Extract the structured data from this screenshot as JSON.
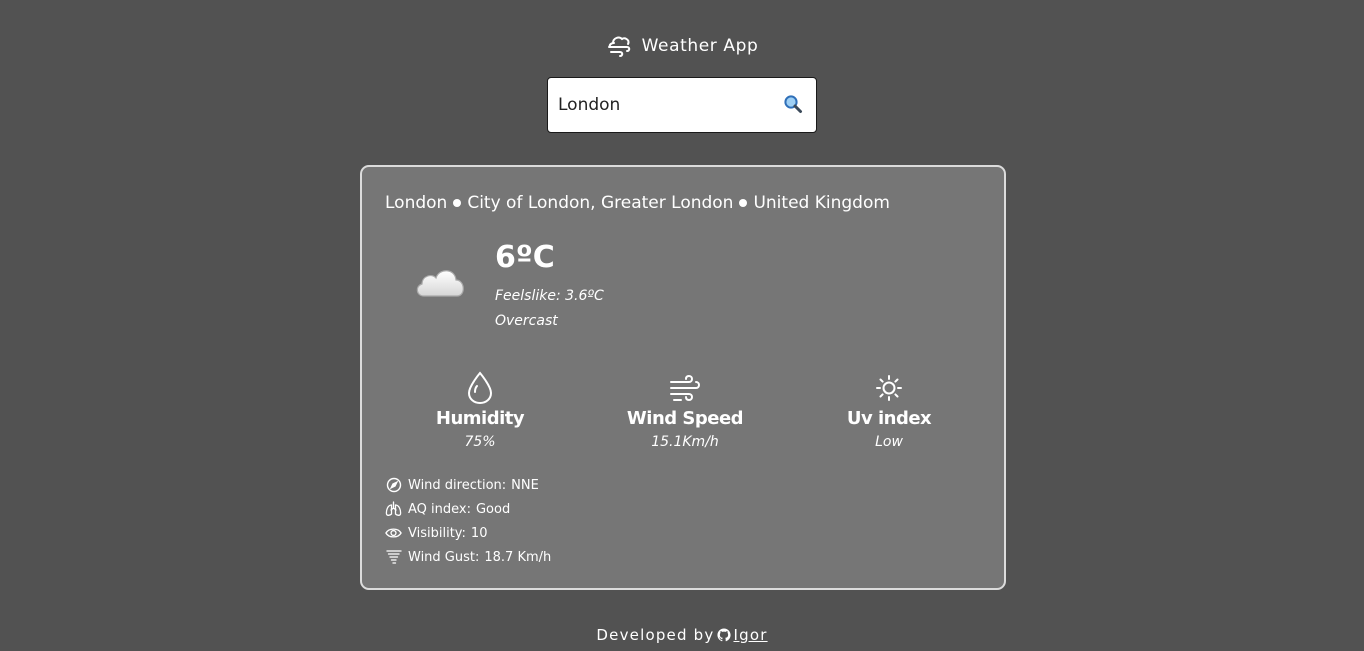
{
  "header": {
    "title": "Weather App",
    "logo_icon": "cloud-wind-icon"
  },
  "search": {
    "value": "London",
    "placeholder": "",
    "icon": "magnifier-icon"
  },
  "location": {
    "city": "London",
    "region": "City of London, Greater London",
    "country": "United Kingdom"
  },
  "current": {
    "temperature": "6ºC",
    "feelslike_label": "Feelslike:",
    "feelslike_value": "3.6ºC",
    "condition": "Overcast",
    "condition_icon": "overcast-cloud-icon"
  },
  "stats": [
    {
      "title": "Humidity",
      "value": "75%",
      "icon": "droplet-icon"
    },
    {
      "title": "Wind Speed",
      "value": "15.1Km/h",
      "icon": "wind-icon"
    },
    {
      "title": "Uv index",
      "value": "Low",
      "icon": "sun-icon"
    }
  ],
  "details": [
    {
      "label": "Wind direction:",
      "value": "NNE",
      "icon": "compass-icon"
    },
    {
      "label": "AQ index:",
      "value": "Good",
      "icon": "lungs-icon"
    },
    {
      "label": "Visibility:",
      "value": "10",
      "icon": "eye-icon"
    },
    {
      "label": "Wind Gust:",
      "value": "18.7 Km/h",
      "icon": "tornado-icon"
    }
  ],
  "footer": {
    "prefix": "Developed by",
    "author": "Igor",
    "icon": "github-icon"
  },
  "colors": {
    "background": "#525252",
    "card": "#767676",
    "card_border": "#dcdcdc",
    "text": "#ffffff",
    "search_icon": "#2f6fb8"
  }
}
